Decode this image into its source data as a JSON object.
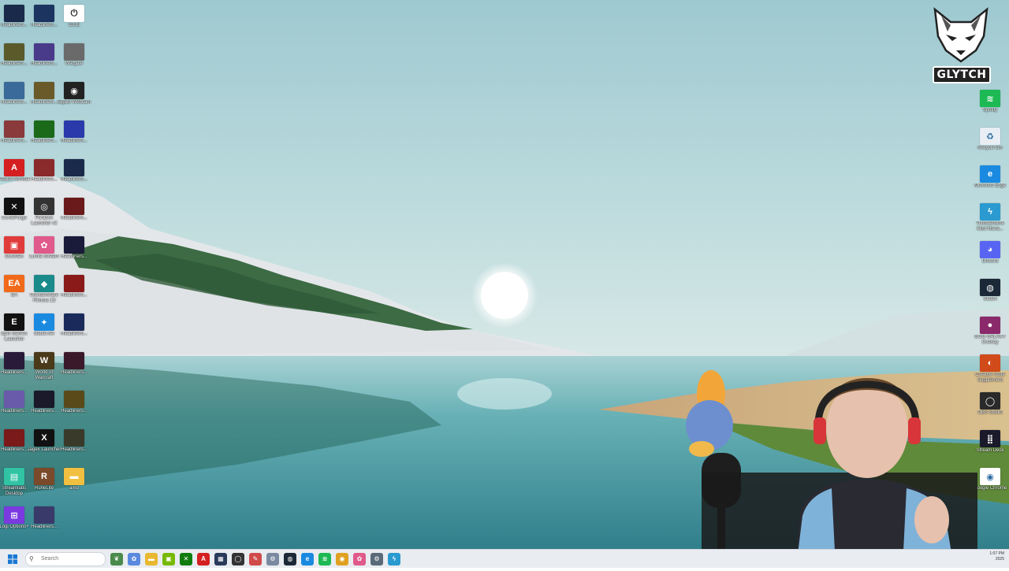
{
  "desktop": {
    "left_icons": [
      {
        "label": "Headliners...",
        "color": "#1a2a4a",
        "glyph": ""
      },
      {
        "label": "Headliners...",
        "color": "#1c3560",
        "glyph": ""
      },
      {
        "label": "iCUE",
        "color": "#ffffff",
        "glyph": "⏻"
      },
      {
        "label": "Headliners...",
        "color": "#5a5a2a",
        "glyph": ""
      },
      {
        "label": "Headliners...",
        "color": "#4a3a8a",
        "glyph": ""
      },
      {
        "label": "Wargate",
        "color": "#6a6a6a",
        "glyph": ""
      },
      {
        "label": "Headliners...",
        "color": "#3a6a9a",
        "glyph": ""
      },
      {
        "label": "Headliners...",
        "color": "#6a5a2a",
        "glyph": ""
      },
      {
        "label": "Elgato Webcam",
        "color": "#222222",
        "glyph": "◉"
      },
      {
        "label": "Headliners...",
        "color": "#8a3a3a",
        "glyph": ""
      },
      {
        "label": "Headliners...",
        "color": "#1a6a1a",
        "glyph": ""
      },
      {
        "label": "Headliners...",
        "color": "#2a3aaa",
        "glyph": ""
      },
      {
        "label": "Adobe Acrobat",
        "color": "#d42020",
        "glyph": "A"
      },
      {
        "label": "Headliners...",
        "color": "#8a2a2a",
        "glyph": ""
      },
      {
        "label": "Headliners...",
        "color": "#1a2a4a",
        "glyph": ""
      },
      {
        "label": "CurseForge",
        "color": "#111111",
        "glyph": "✕"
      },
      {
        "label": "Paradox Launcher v2",
        "color": "#333333",
        "glyph": "◎"
      },
      {
        "label": "Headliners...",
        "color": "#6a1a1a",
        "glyph": ""
      },
      {
        "label": "DouWan",
        "color": "#e03a3a",
        "glyph": "▣"
      },
      {
        "label": "Lumia Stream",
        "color": "#e05a8a",
        "glyph": "✿"
      },
      {
        "label": "Headliners...",
        "color": "#1a1a3a",
        "glyph": ""
      },
      {
        "label": "EA",
        "color": "#f06a1a",
        "glyph": "EA"
      },
      {
        "label": "Wondershare Filmora 13",
        "color": "#1a8a8a",
        "glyph": "◆"
      },
      {
        "label": "Headliners...",
        "color": "#8a1a1a",
        "glyph": ""
      },
      {
        "label": "Epic Games Launcher",
        "color": "#111111",
        "glyph": "E"
      },
      {
        "label": "Battle.net",
        "color": "#1a8ae0",
        "glyph": "✦"
      },
      {
        "label": "Headliners...",
        "color": "#1a2a5a",
        "glyph": ""
      },
      {
        "label": "Headliners...",
        "color": "#2a1a3a",
        "glyph": ""
      },
      {
        "label": "World of Warcraft",
        "color": "#4a3a1a",
        "glyph": "W"
      },
      {
        "label": "Headliners...",
        "color": "#3a1a2a",
        "glyph": ""
      },
      {
        "label": "Headliners...",
        "color": "#6a5aaa",
        "glyph": ""
      },
      {
        "label": "Headliners...",
        "color": "#1a1a2a",
        "glyph": ""
      },
      {
        "label": "Headliners...",
        "color": "#5a4a1a",
        "glyph": ""
      },
      {
        "label": "Headliners...",
        "color": "#7a1a1a",
        "glyph": ""
      },
      {
        "label": "Jagex Launcher",
        "color": "#111111",
        "glyph": "X"
      },
      {
        "label": "Headliners...",
        "color": "#3a3a2a",
        "glyph": ""
      },
      {
        "label": "Streamlabs Desktop",
        "color": "#30c4a4",
        "glyph": "▤"
      },
      {
        "label": "RuneLite",
        "color": "#7a4a2a",
        "glyph": "R"
      },
      {
        "label": "amd",
        "color": "#f2c040",
        "glyph": "▬"
      },
      {
        "label": "Logi Options+",
        "color": "#7a3ae0",
        "glyph": "⊞"
      },
      {
        "label": "Headliners...",
        "color": "#3a3a6a",
        "glyph": ""
      }
    ],
    "right_icons": [
      {
        "label": "Spotify",
        "color": "#1db954",
        "glyph": "≋"
      },
      {
        "label": "Recycle Bin",
        "color": "#e8eef4",
        "glyph": "♻"
      },
      {
        "label": "Microsoft Edge",
        "color": "#1a8ae0",
        "glyph": "e"
      },
      {
        "label": "Thunderstore Mod Mana...",
        "color": "#2a9ad0",
        "glyph": "ϟ"
      },
      {
        "label": "Discord",
        "color": "#5865f2",
        "glyph": "◕"
      },
      {
        "label": "Steam",
        "color": "#1b2838",
        "glyph": "◍"
      },
      {
        "label": "GOG GALAXY Overlay",
        "color": "#8a2a6a",
        "glyph": "●"
      },
      {
        "label": "Creative Suite Supplement",
        "color": "#d04a1a",
        "glyph": "◐"
      },
      {
        "label": "OBS Studio",
        "color": "#2a2a2a",
        "glyph": "◯"
      },
      {
        "label": "Stream Deck",
        "color": "#1a1a2a",
        "glyph": "⣿"
      },
      {
        "label": "Google Chrome",
        "color": "#ffffff",
        "glyph": "◉"
      }
    ]
  },
  "overlay": {
    "brand_text": "GLYTCH"
  },
  "taskbar": {
    "search_placeholder": "Search",
    "apps": [
      {
        "name": "app-leaf",
        "color": "#4a8a4a",
        "glyph": "❦"
      },
      {
        "name": "app-copilot",
        "color": "#5a8ae0",
        "glyph": "✿"
      },
      {
        "name": "app-explorer",
        "color": "#e8b830",
        "glyph": "▬"
      },
      {
        "name": "app-nvidia",
        "color": "#76b900",
        "glyph": "▣"
      },
      {
        "name": "app-xbox",
        "color": "#107c10",
        "glyph": "✕"
      },
      {
        "name": "app-acrobat",
        "color": "#d42020",
        "glyph": "A"
      },
      {
        "name": "app-terminal",
        "color": "#2a3a5a",
        "glyph": "▦"
      },
      {
        "name": "app-obs",
        "color": "#333333",
        "glyph": "◯"
      },
      {
        "name": "app-paint",
        "color": "#d04a4a",
        "glyph": "✎"
      },
      {
        "name": "app-settings",
        "color": "#7a8aa0",
        "glyph": "⚙"
      },
      {
        "name": "app-steam",
        "color": "#1b2838",
        "glyph": "◍"
      },
      {
        "name": "app-edge",
        "color": "#1a8ae0",
        "glyph": "e"
      },
      {
        "name": "app-spotify",
        "color": "#1db954",
        "glyph": "≋"
      },
      {
        "name": "app-chrome",
        "color": "#e0a020",
        "glyph": "◉"
      },
      {
        "name": "app-lumia",
        "color": "#e05a8a",
        "glyph": "✿"
      },
      {
        "name": "app-gear",
        "color": "#5a6a7a",
        "glyph": "⚙"
      },
      {
        "name": "app-thunderstore",
        "color": "#2a9ad0",
        "glyph": "ϟ"
      }
    ],
    "time": "1:07 PM",
    "date": "2025"
  }
}
